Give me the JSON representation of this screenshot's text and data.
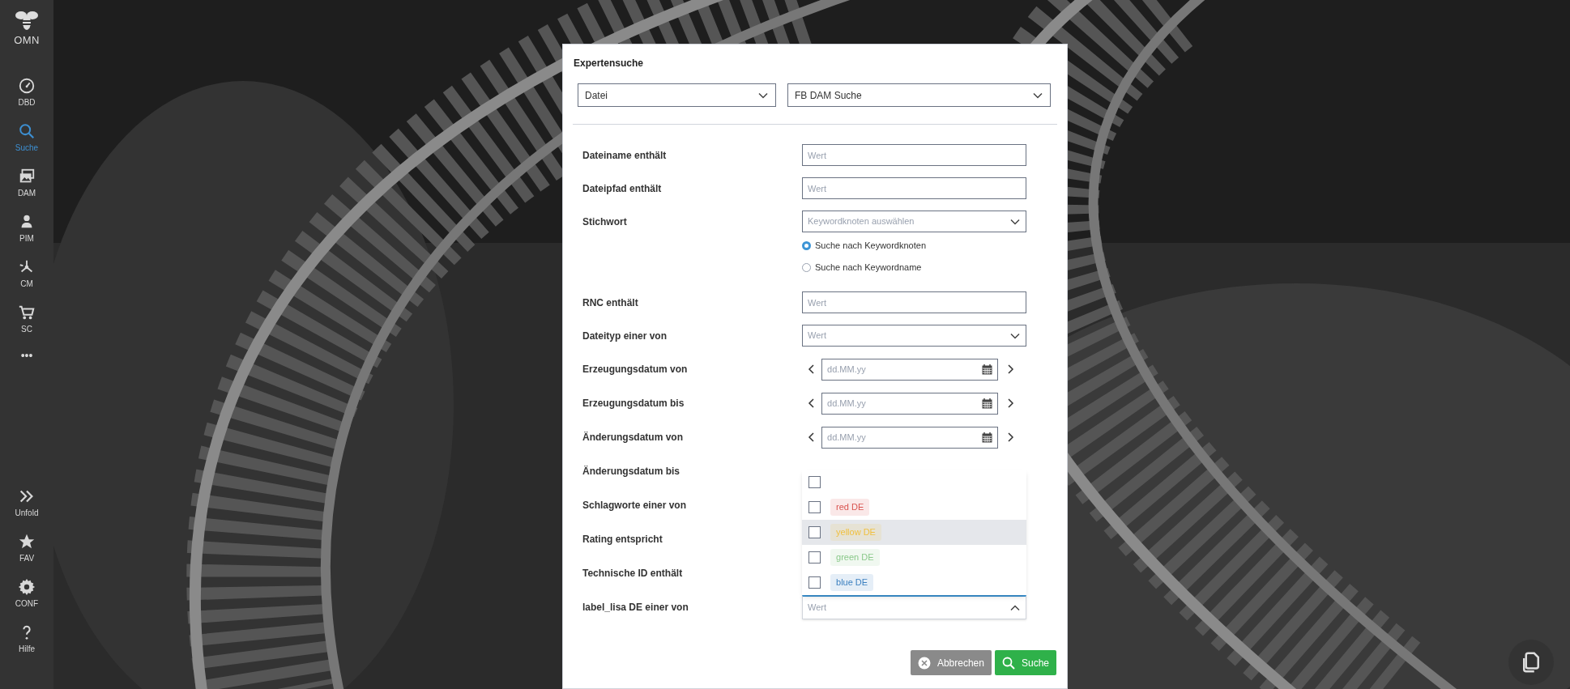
{
  "sidebar": {
    "logo": "OMN",
    "items": [
      {
        "label": "DBD",
        "selected": false
      },
      {
        "label": "Suche",
        "selected": true
      },
      {
        "label": "DAM",
        "selected": false
      },
      {
        "label": "PIM",
        "selected": false
      },
      {
        "label": "CM",
        "selected": false
      },
      {
        "label": "SC",
        "selected": false
      }
    ],
    "more": "•••",
    "bottom_items": [
      {
        "label": "Unfold"
      },
      {
        "label": "FAV"
      },
      {
        "label": "CONF"
      },
      {
        "label": "Hilfe"
      }
    ]
  },
  "dialog": {
    "title": "Expertensuche",
    "selects": [
      {
        "value": "Datei"
      },
      {
        "value": "FB DAM Suche"
      }
    ],
    "rows": [
      {
        "kind": "text",
        "label": "Dateiname enthält",
        "placeholder": "Wert"
      },
      {
        "kind": "text",
        "label": "Dateipfad enthält",
        "placeholder": "Wert"
      },
      {
        "kind": "select",
        "label": "Stichwort",
        "placeholder": "Keywordknoten auswählen"
      },
      {
        "kind": "radio",
        "options": [
          {
            "label": "Suche nach Keywordknoten",
            "selected": true
          },
          {
            "label": "Suche nach Keywordname",
            "selected": false
          }
        ]
      },
      {
        "kind": "text",
        "label": "RNC enthält",
        "placeholder": "Wert"
      },
      {
        "kind": "select",
        "label": "Dateityp einer von",
        "placeholder": "Wert"
      },
      {
        "kind": "date",
        "label": "Erzeugungsdatum von",
        "placeholder": "dd.MM.yy"
      },
      {
        "kind": "date",
        "label": "Erzeugungsdatum bis",
        "placeholder": "dd.MM.yy"
      },
      {
        "kind": "date",
        "label": "Änderungsdatum von",
        "placeholder": "dd.MM.yy"
      },
      {
        "kind": "covered",
        "label": "Änderungsdatum bis"
      },
      {
        "kind": "covered",
        "label": "Schlagworte einer von"
      },
      {
        "kind": "covered",
        "label": "Rating entspricht"
      },
      {
        "kind": "covered",
        "label": "Technische ID enthält"
      },
      {
        "kind": "multiselect",
        "label": "label_lisa DE einer von",
        "placeholder": "Wert",
        "expanded": true,
        "options": [
          {
            "checked": false,
            "hovered": false
          },
          {
            "label": "red DE",
            "color": "#d9534f",
            "checked": false,
            "hovered": false
          },
          {
            "label": "yellow DE",
            "color": "#f0c040",
            "checked": false,
            "hovered": true
          },
          {
            "label": "green DE",
            "color": "#8bc98b",
            "checked": false,
            "hovered": false
          },
          {
            "label": "blue DE",
            "color": "#3a7fc0",
            "checked": false,
            "hovered": false
          }
        ]
      }
    ],
    "buttons": [
      {
        "kind": "cancel",
        "label": "Abbrechen"
      },
      {
        "kind": "search",
        "label": "Suche"
      }
    ]
  }
}
